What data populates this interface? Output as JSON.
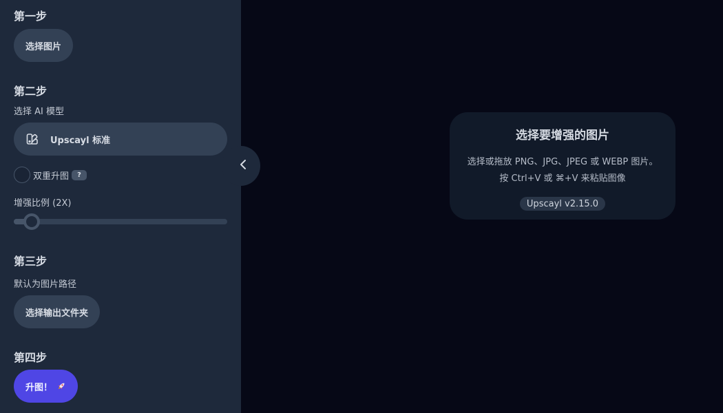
{
  "sidebar": {
    "step1": {
      "title": "第一步",
      "button_label": "选择图片"
    },
    "step2": {
      "title": "第二步",
      "model_label": "选择 AI 模型",
      "model_selected": "Upscayl 标准",
      "model_icon": "model-icon",
      "double_upscale_label": "双重升图",
      "double_upscale_checked": false,
      "help_label": "?",
      "scale_label": "增强比例 (2X)",
      "scale_slider_fraction": 0.07
    },
    "step3": {
      "title": "第三步",
      "output_label": "默认为图片路径",
      "button_label": "选择输出文件夹"
    },
    "step4": {
      "title": "第四步",
      "button_label": "升图！",
      "icon": "rocket-icon"
    }
  },
  "collapse_icon": "chevron-left-icon",
  "main": {
    "title": "选择要增强的图片",
    "desc_line1": "选择或拖放 PNG、JPG、JPEG 或 WEBP 图片。",
    "desc_line2": "按 Ctrl+V 或 ⌘+V 来粘贴图像",
    "version": "Upscayl v2.15.0"
  },
  "colors": {
    "background": "#060816",
    "sidebar": "#1e293b",
    "button": "#334155",
    "accent": "#4f46e5"
  }
}
